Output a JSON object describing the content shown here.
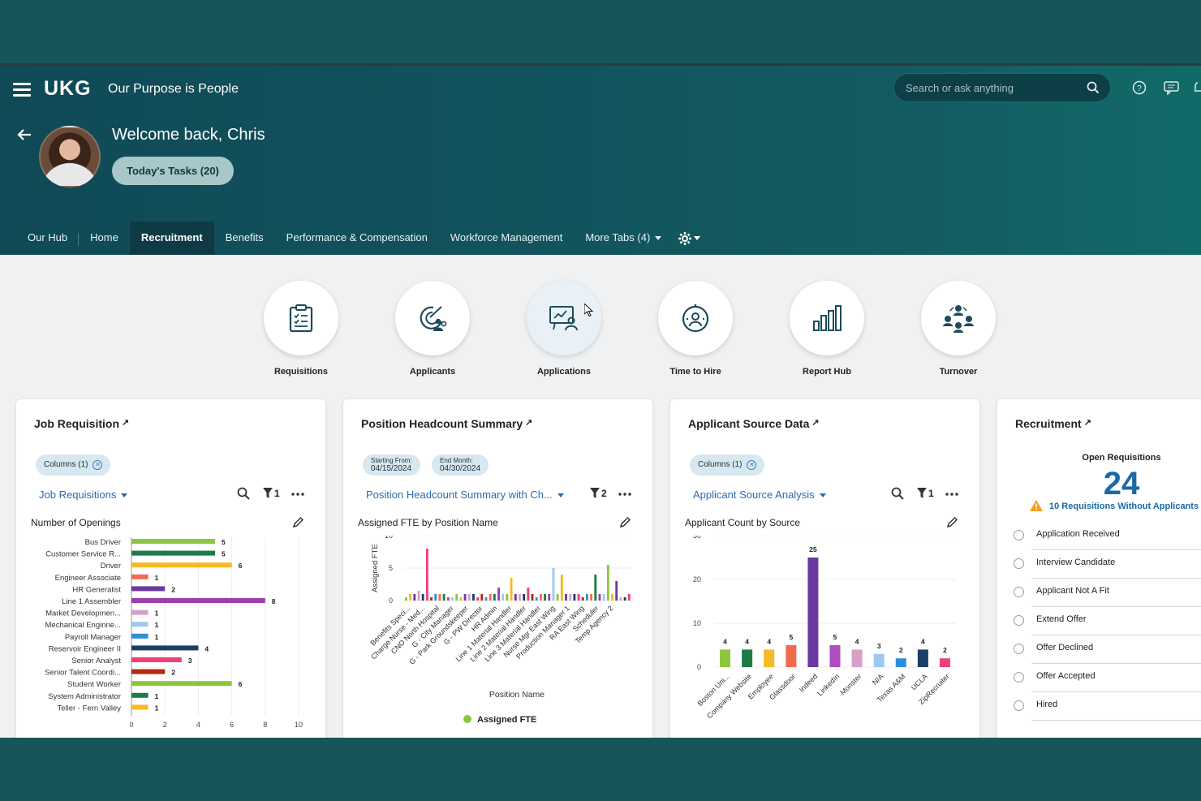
{
  "header": {
    "logo": "UKG",
    "tagline": "Our Purpose is People",
    "search_placeholder": "Search or ask anything",
    "welcome": "Welcome back, Chris",
    "tasks_button": "Today's Tasks (20)"
  },
  "tabs": [
    {
      "label": "Our Hub"
    },
    {
      "label": "Home"
    },
    {
      "label": "Recruitment",
      "active": true
    },
    {
      "label": "Benefits"
    },
    {
      "label": "Performance & Compensation"
    },
    {
      "label": "Workforce Management"
    },
    {
      "label": "More Tabs  (4)"
    }
  ],
  "tiles": [
    {
      "label": "Requisitions",
      "icon": "clipboard-icon"
    },
    {
      "label": "Applicants",
      "icon": "target-people-icon"
    },
    {
      "label": "Applications",
      "icon": "presentation-icon"
    },
    {
      "label": "Time to Hire",
      "icon": "stopwatch-person-icon"
    },
    {
      "label": "Report Hub",
      "icon": "bar-chart-icon"
    },
    {
      "label": "Turnover",
      "icon": "people-cycle-icon"
    }
  ],
  "cards": {
    "job_req": {
      "title": "Job Requisition",
      "chip": "Columns (1)",
      "view": "Job Requisitions",
      "filter_count": "1",
      "subtitle": "Number of Openings"
    },
    "headcount": {
      "title": "Position Headcount Summary",
      "chip_start_label": "Starting From:",
      "chip_start_date": "04/15/2024",
      "chip_end_label": "End Month:",
      "chip_end_date": "04/30/2024",
      "view": "Position Headcount Summary with Ch...",
      "filter_count": "2",
      "subtitle": "Assigned FTE by Position Name"
    },
    "source": {
      "title": "Applicant Source Data",
      "chip": "Columns (1)",
      "view": "Applicant Source Analysis",
      "filter_count": "1",
      "subtitle": "Applicant Count by Source"
    },
    "recruitment": {
      "title": "Recruitment",
      "open_label": "Open Requisitions",
      "open_count": "24",
      "warning": "10 Requisitions Without Applicants",
      "steps": [
        "Application Received",
        "Interview Candidate",
        "Applicant Not A Fit",
        "Extend Offer",
        "Offer Declined",
        "Offer Accepted",
        "Hired"
      ]
    }
  },
  "chart_data": [
    {
      "type": "bar",
      "orientation": "horizontal",
      "title": "Number of Openings",
      "categories": [
        "Bus Driver",
        "Customer Service R...",
        "Driver",
        "Engineer Associate",
        "HR Generalist",
        "Line 1 Assembler",
        "Market Developmen...",
        "Mechanical Enginne...",
        "Payroll Manager",
        "Reservoir Engineer II",
        "Senior Analyst",
        "Senior Talent Coordi...",
        "Student Worker",
        "System Administrator",
        "Teller - Fern Valley"
      ],
      "values": [
        5,
        5,
        6,
        1,
        2,
        8,
        1,
        1,
        1,
        4,
        3,
        2,
        6,
        1,
        1
      ],
      "colors": [
        "#8cc63f",
        "#1e7b45",
        "#f7b924",
        "#f26b4f",
        "#6b3aa0",
        "#9b3fae",
        "#d7a0c8",
        "#9ec9ee",
        "#2f8fd6",
        "#1a3f66",
        "#ef3f7a",
        "#b22a10",
        "#8cc63f",
        "#1e7b45",
        "#f7b924"
      ],
      "xlim": [
        0,
        10
      ],
      "xticks": [
        "0",
        "2",
        "4",
        "6",
        "8",
        "10"
      ]
    },
    {
      "type": "bar",
      "title": "Assigned FTE by Position Name",
      "xlabel": "Position Name",
      "ylabel": "Assigned FTE",
      "ylim": [
        0,
        10
      ],
      "yticks": [
        "0",
        "5",
        "10"
      ],
      "xticklabels": [
        "Benefits Speci...",
        "Charge Nurse - Med...",
        "CNO North Hospital",
        "G - City Manager",
        "G - Park Groundskeeper",
        "G - PW Director",
        "HR Admin",
        "Line 1 Material Handler",
        "Line 2 Material Handler",
        "Line 3 Material Handler",
        "Nurse Mgr East Wing",
        "Production Manager 1",
        "RA East Wing",
        "Scheduler",
        "Temp Agency 2"
      ],
      "series": [
        {
          "name": "Assigned FTE",
          "values": [
            0.5,
            1,
            1,
            1.5,
            1,
            8,
            0.5,
            1,
            1,
            1,
            0.5,
            0.5,
            1,
            0.5,
            1,
            1,
            1,
            0.5,
            1,
            0.5,
            1,
            1,
            2,
            1,
            1,
            3.5,
            1,
            1,
            1,
            2,
            1,
            0.5,
            1,
            1,
            1,
            5,
            1,
            4,
            1,
            1,
            1,
            1,
            0.5,
            1,
            1,
            4,
            1,
            1,
            5.5,
            1,
            3,
            0.5,
            0.5,
            1
          ]
        }
      ],
      "legend": "bottom"
    },
    {
      "type": "bar",
      "title": "Applicant Count by Source",
      "categories": [
        "Boston Uni...",
        "Company Website",
        "Employee",
        "Glassdoor",
        "Indeed",
        "LinkedIn",
        "Monster",
        "N/A",
        "Texas A&M",
        "UCLA",
        "ZipRecruiter"
      ],
      "values": [
        4,
        4,
        4,
        5,
        25,
        5,
        4,
        3,
        2,
        4,
        2
      ],
      "colors": [
        "#8cc63f",
        "#1e7b45",
        "#f7b924",
        "#f26b4f",
        "#6b3aa0",
        "#b04dbd",
        "#d7a0c8",
        "#9ec9ee",
        "#2f8fd6",
        "#1a3f66",
        "#ef3f7a"
      ],
      "ylim": [
        0,
        30
      ],
      "yticks": [
        "0",
        "10",
        "20",
        "30"
      ]
    }
  ]
}
